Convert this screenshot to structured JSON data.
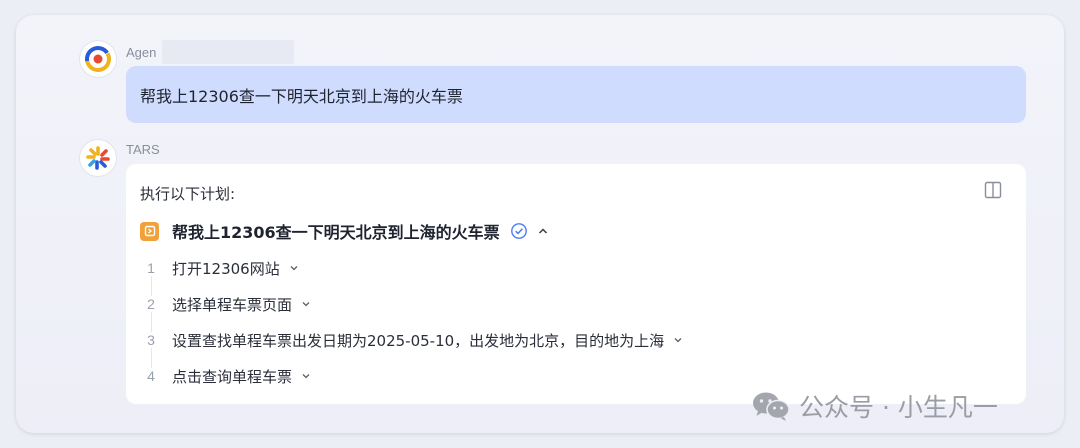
{
  "conversation": {
    "user": {
      "sender_name": "Agen",
      "avatar_icon": "agent-logo-icon",
      "message": "帮我上12306查一下明天北京到上海的火车票"
    },
    "assistant": {
      "sender_name": "TARS",
      "avatar_icon": "tars-logo-icon",
      "plan_intro": "执行以下计划:",
      "task": {
        "title": "帮我上12306查一下明天北京到上海的火车票",
        "status": "completed",
        "expanded": true
      },
      "steps": [
        {
          "num": "1",
          "text": "打开12306网站"
        },
        {
          "num": "2",
          "text": "选择单程车票页面"
        },
        {
          "num": "3",
          "text": "设置查找单程车票出发日期为2025-05-10，出发地为北京，目的地为上海"
        },
        {
          "num": "4",
          "text": "点击查询单程车票"
        }
      ]
    }
  },
  "watermark": {
    "text": "公众号 · 小生凡一",
    "icon": "wechat-icon"
  },
  "colors": {
    "user_bubble": "#cfdcfd",
    "task_icon": "#f0a139",
    "check": "#4a7ef0"
  }
}
